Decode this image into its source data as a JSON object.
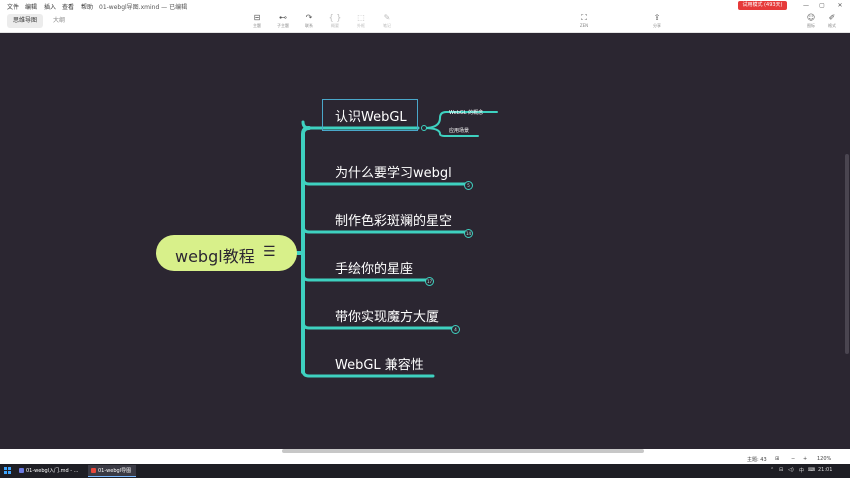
{
  "menubar": {
    "menus": [
      "文件",
      "编辑",
      "插入",
      "查看",
      "帮助"
    ],
    "doc_title": "01-webgl导图.xmind — 已编辑",
    "trial_badge": "试用模式 (493天)",
    "window_controls": [
      "—",
      "▢",
      "✕"
    ]
  },
  "toolbar": {
    "view_tabs": [
      {
        "label": "思维导图",
        "active": true
      },
      {
        "label": "大纲",
        "active": false
      }
    ],
    "tools": [
      {
        "label": "主题",
        "icon": "topic-icon",
        "disabled": false
      },
      {
        "label": "子主题",
        "icon": "subtopic-icon",
        "disabled": false
      },
      {
        "label": "联系",
        "icon": "relationship-icon",
        "disabled": false
      },
      {
        "label": "概要",
        "icon": "summary-icon",
        "disabled": true
      },
      {
        "label": "外框",
        "icon": "boundary-icon",
        "disabled": true
      },
      {
        "label": "笔记",
        "icon": "note-icon",
        "disabled": true
      }
    ],
    "zen_label": "ZEN",
    "share_label": "分享",
    "icons_label": "图标",
    "format_label": "格式"
  },
  "mindmap": {
    "root": {
      "label": "webgl教程",
      "color": "#d8f08a",
      "icon": "notes-icon"
    },
    "branch_color": "#3ed1c0",
    "topics": [
      {
        "label": "认识WebGL",
        "selected": true,
        "badge": null,
        "subtopics": [
          "WebGL 的概念",
          "应用场景"
        ]
      },
      {
        "label": "为什么要学习webgl",
        "selected": false,
        "badge": "5",
        "subtopics": []
      },
      {
        "label": "制作色彩斑斓的星空",
        "selected": false,
        "badge": "14",
        "subtopics": []
      },
      {
        "label": "手绘你的星座",
        "selected": false,
        "badge": "17",
        "subtopics": []
      },
      {
        "label": "带你实现魔方大厦",
        "selected": false,
        "badge": "4",
        "subtopics": []
      },
      {
        "label": "WebGL 兼容性",
        "selected": false,
        "badge": null,
        "subtopics": []
      }
    ]
  },
  "statusbar": {
    "topic_count": "主题: 43",
    "zoom": "120%",
    "zoom_minus": "−",
    "zoom_plus": "+"
  },
  "taskbar": {
    "items": [
      {
        "label": "01-webgl入门.md - ...",
        "active": false
      },
      {
        "label": "01-webgl导图",
        "active": true
      }
    ],
    "time": "21:01",
    "ime": "中"
  }
}
